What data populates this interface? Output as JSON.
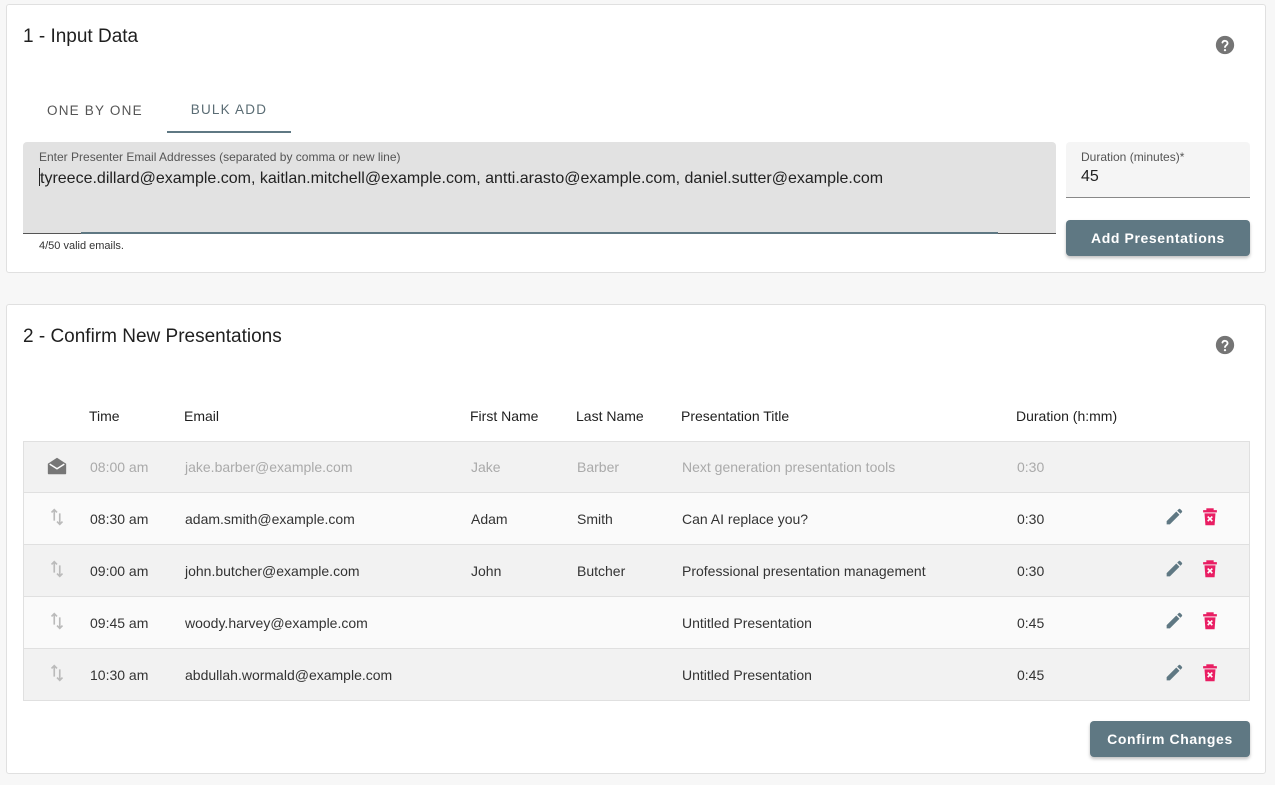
{
  "section1": {
    "title": "1 - Input Data",
    "tabs": [
      {
        "label": "ONE BY ONE",
        "active": false
      },
      {
        "label": "BULK ADD",
        "active": true
      }
    ],
    "emails_label": "Enter Presenter Email Addresses (separated by comma or new line)",
    "emails_value": "tyreece.dillard@example.com, kaitlan.mitchell@example.com, antti.arasto@example.com, daniel.sutter@example.com",
    "valid_hint": "4/50 valid emails.",
    "duration_label": "Duration (minutes)*",
    "duration_value": "45",
    "add_button": "Add Presentations"
  },
  "section2": {
    "title": "2 - Confirm New Presentations",
    "columns": [
      "Time",
      "Email",
      "First Name",
      "Last Name",
      "Presentation Title",
      "Duration (h:mm)"
    ],
    "rows": [
      {
        "icon": "envelope-open-icon",
        "time": "08:00 am",
        "email": "jake.barber@example.com",
        "first": "Jake",
        "last": "Barber",
        "title": "Next generation presentation tools",
        "duration": "0:30",
        "editable": false
      },
      {
        "icon": "reorder-icon",
        "time": "08:30 am",
        "email": "adam.smith@example.com",
        "first": "Adam",
        "last": "Smith",
        "title": "Can AI replace you?",
        "duration": "0:30",
        "editable": true
      },
      {
        "icon": "reorder-icon",
        "time": "09:00 am",
        "email": "john.butcher@example.com",
        "first": "John",
        "last": "Butcher",
        "title": "Professional presentation management",
        "duration": "0:30",
        "editable": true
      },
      {
        "icon": "reorder-icon",
        "time": "09:45 am",
        "email": "woody.harvey@example.com",
        "first": "",
        "last": "",
        "title": "Untitled Presentation",
        "duration": "0:45",
        "editable": true
      },
      {
        "icon": "reorder-icon",
        "time": "10:30 am",
        "email": "abdullah.wormald@example.com",
        "first": "",
        "last": "",
        "title": "Untitled Presentation",
        "duration": "0:45",
        "editable": true
      }
    ],
    "confirm_button": "Confirm Changes"
  },
  "colors": {
    "accent": "#5f7883",
    "delete": "#e91e63",
    "help": "#757575"
  }
}
